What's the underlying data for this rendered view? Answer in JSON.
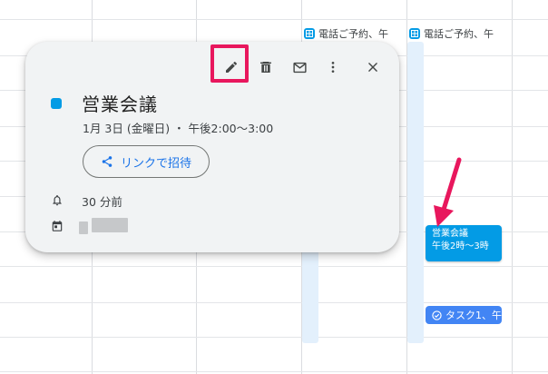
{
  "calendar": {
    "top_chips": [
      {
        "label": "電話ご予約、午"
      },
      {
        "label": "電話ご予約、午"
      }
    ],
    "event_block": {
      "title": "営業会議",
      "time": "午後2時〜3時"
    },
    "task_chip": {
      "label": "タスク1、午"
    }
  },
  "popup": {
    "title": "営業会議",
    "datetime": "1月 3日 (金曜日) ・ 午後2:00〜3:00",
    "invite_label": "リンクで招待",
    "reminder": "30 分前",
    "calendar_color": "#039be5"
  },
  "colors": {
    "event_blue": "#039be5",
    "task_blue": "#4285f4",
    "highlight": "#e8175d",
    "column_shade": "#e3f0fc"
  }
}
